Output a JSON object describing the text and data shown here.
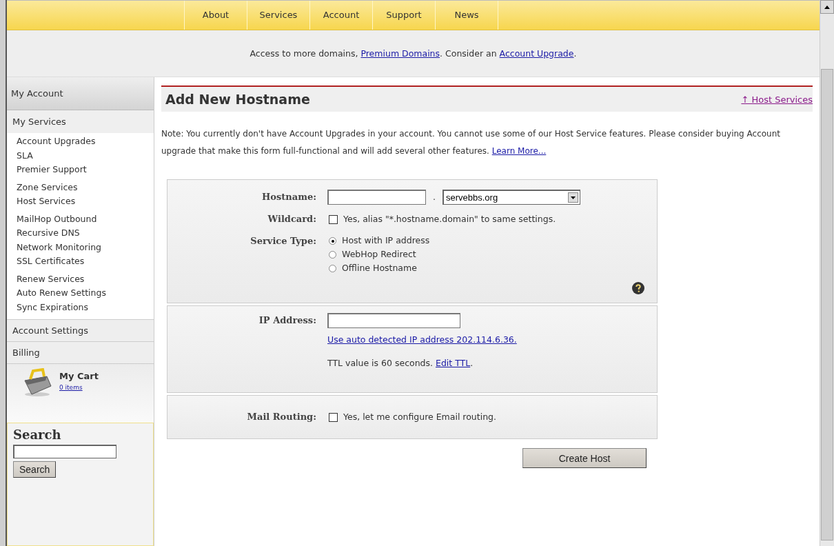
{
  "nav": {
    "items": [
      "About",
      "Services",
      "Account",
      "Support",
      "News"
    ]
  },
  "announcement": {
    "lead": "Access to more domains,",
    "link_1": "Premium Domains",
    "middle": ". Consider an",
    "link_2": "Account Upgrade",
    "end": "."
  },
  "sidebar": {
    "title": "My Account",
    "services_heading": "My Services",
    "service_groups": [
      [
        "Account Upgrades",
        "SLA",
        "Premier Support"
      ],
      [
        "Zone Services",
        "Host Services"
      ],
      [
        "MailHop Outbound",
        "Recursive DNS",
        "Network Monitoring",
        "SSL Certificates"
      ],
      [
        "Renew Services",
        "Auto Renew Settings",
        "Sync Expirations"
      ]
    ],
    "links": [
      "Account Settings",
      "Billing"
    ],
    "cart": {
      "title": "My Cart",
      "count": "0 items"
    },
    "search": {
      "title": "Search",
      "button": "Search"
    }
  },
  "page": {
    "title": "Add New Hostname",
    "back_link": "↑ Host Services",
    "note": {
      "text": "Note: You currently don't have Account Upgrades in your account. You cannot use some of our Host Service features. Please consider buying Account upgrade that make this form full-functional and will add several other features.",
      "link": "Learn More..."
    }
  },
  "form": {
    "hostname": {
      "label": "Hostname:",
      "separator": ".",
      "domain": "servebbs.org"
    },
    "wildcard": {
      "label": "Wildcard:",
      "checked": false,
      "text": "Yes, alias \"*.hostname.domain\" to same settings."
    },
    "service_type": {
      "label": "Service Type:",
      "options": [
        {
          "label": "Host with IP address",
          "selected": true
        },
        {
          "label": "WebHop Redirect",
          "selected": false
        },
        {
          "label": "Offline Hostname",
          "selected": false
        }
      ]
    },
    "ip": {
      "label": "IP Address:",
      "auto_link": "Use auto detected IP address 202.114.6.36.",
      "ttl_text": "TTL value is 60 seconds.",
      "ttl_link": "Edit TTL",
      "ttl_end": "."
    },
    "mail": {
      "label": "Mail Routing:",
      "checked": false,
      "text": "Yes, let me configure Email routing."
    },
    "submit": "Create Host"
  }
}
